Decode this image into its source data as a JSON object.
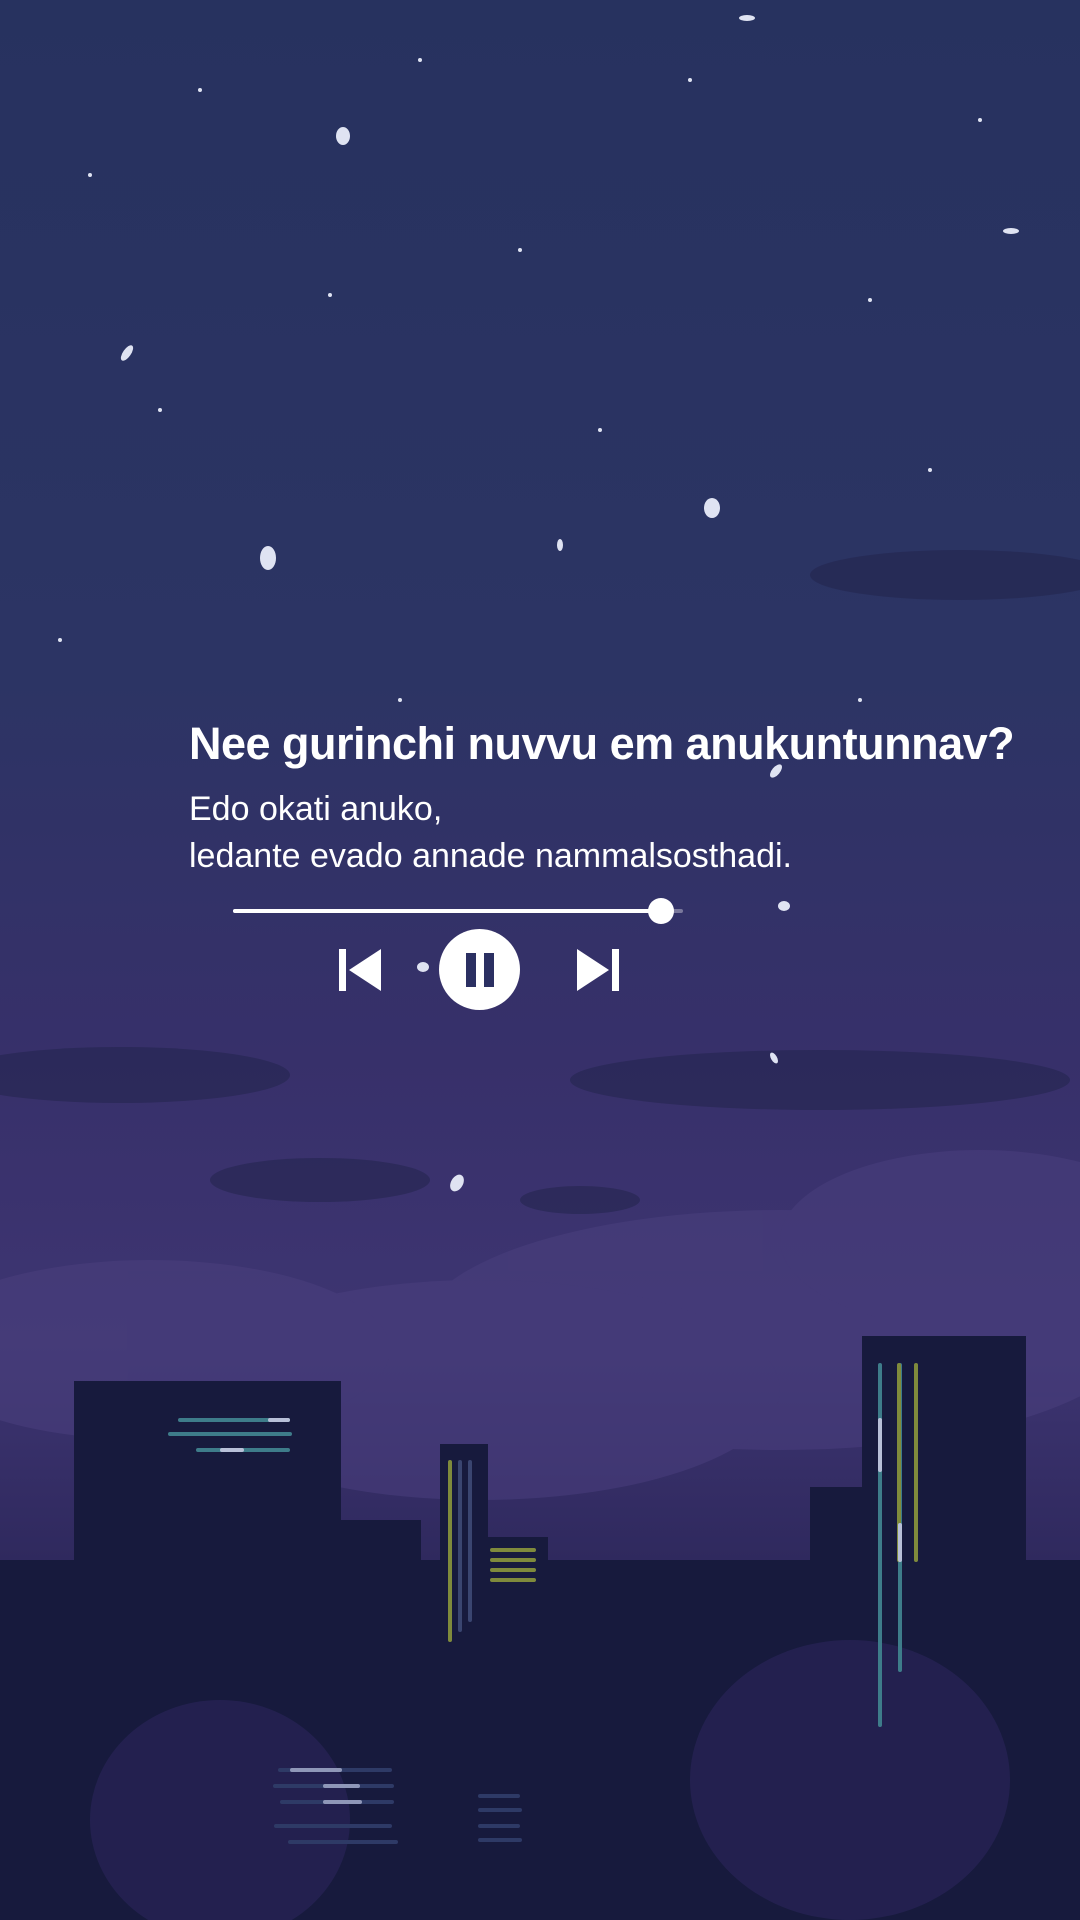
{
  "player": {
    "title": "Nee gurinchi nuvvu em anukuntunnav?",
    "lyrics": [
      "Edo okati anuko,",
      "ledante evado annade nammalsosthadi."
    ],
    "progress": 0.95,
    "state": "playing"
  },
  "controls": {
    "prev_icon": "skip-previous-icon",
    "play_pause_icon": "pause-icon",
    "next_icon": "skip-next-icon"
  },
  "colors": {
    "sky_top": "#27325f",
    "sky_mid": "#37306a",
    "buildings": "#171a3d",
    "text": "#ffffff"
  }
}
